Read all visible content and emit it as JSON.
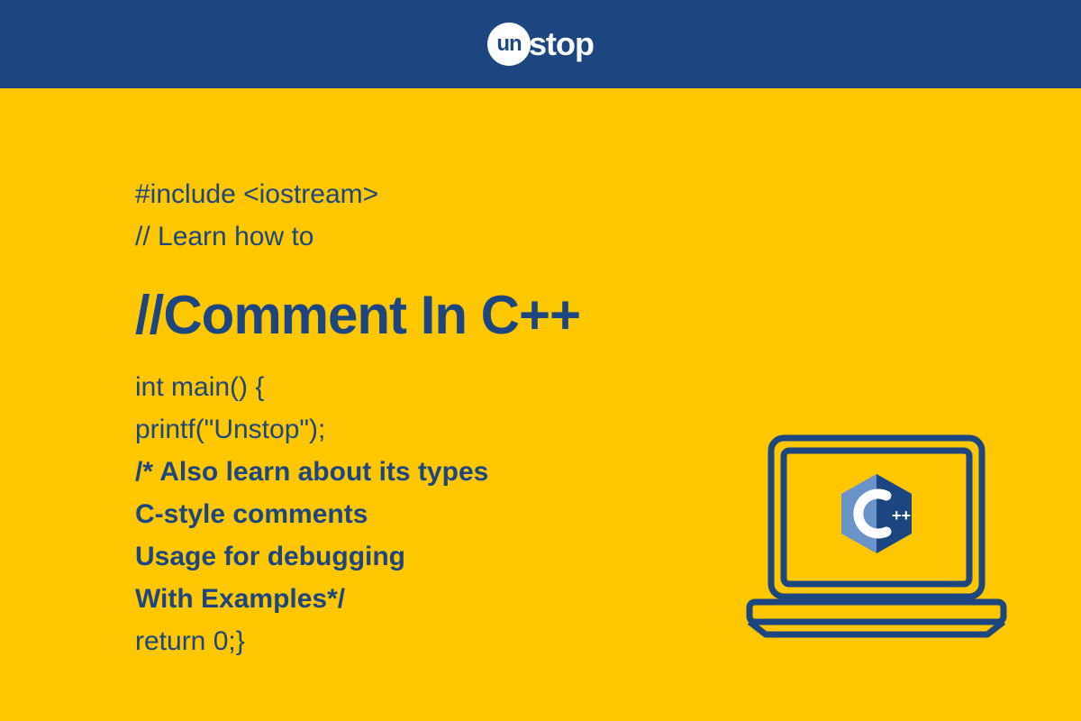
{
  "header": {
    "brand_prefix": "un",
    "brand_suffix": "stop"
  },
  "code": {
    "include": "#include <iostream>",
    "learn": "// Learn how to",
    "title": "//Comment In C++",
    "main": "int main() {",
    "printf": "printf(\"Unstop\");",
    "comment1": "/* Also learn about its types",
    "comment2": "C-style comments",
    "comment3": "Usage for debugging",
    "comment4": "With Examples*/",
    "return": "return 0;}"
  },
  "cpp_badge": "C++"
}
